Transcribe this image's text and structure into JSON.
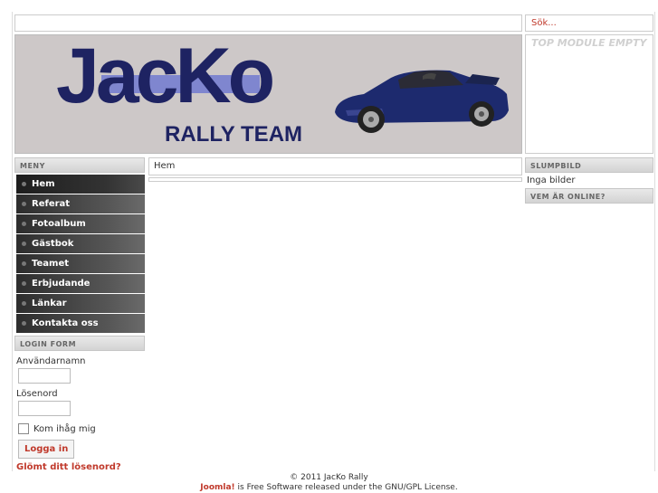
{
  "search": {
    "placeholder": "Sök..."
  },
  "banner": {
    "logo_text": "JacKo",
    "subtitle": "RALLY TEAM"
  },
  "top_module": {
    "text": "TOP MODULE EMPTY"
  },
  "menu": {
    "title": "MENY",
    "items": [
      {
        "label": "Hem"
      },
      {
        "label": "Referat"
      },
      {
        "label": "Fotoalbum"
      },
      {
        "label": "Gästbok"
      },
      {
        "label": "Teamet"
      },
      {
        "label": "Erbjudande"
      },
      {
        "label": "Länkar"
      },
      {
        "label": "Kontakta oss"
      }
    ]
  },
  "login": {
    "title": "LOGIN FORM",
    "username_label": "Användarnamn",
    "password_label": "Lösenord",
    "remember_label": "Kom ihåg mig",
    "submit_label": "Logga in",
    "forgot_label": "Glömt ditt lösenord?"
  },
  "breadcrumb": {
    "text": "Hem"
  },
  "random_image": {
    "title": "SLUMPBILD",
    "text": "Inga bilder"
  },
  "online": {
    "title": "VEM ÄR ONLINE?"
  },
  "footer": {
    "copyright": "© 2011 JacKo Rally",
    "joomla": "Joomla!",
    "license": " is Free Software released under the GNU/GPL License."
  },
  "colors": {
    "accent": "#c0392b",
    "logo": "#1e2362",
    "banner_bg": "#cdc8c8",
    "band": "#7f86cf"
  }
}
